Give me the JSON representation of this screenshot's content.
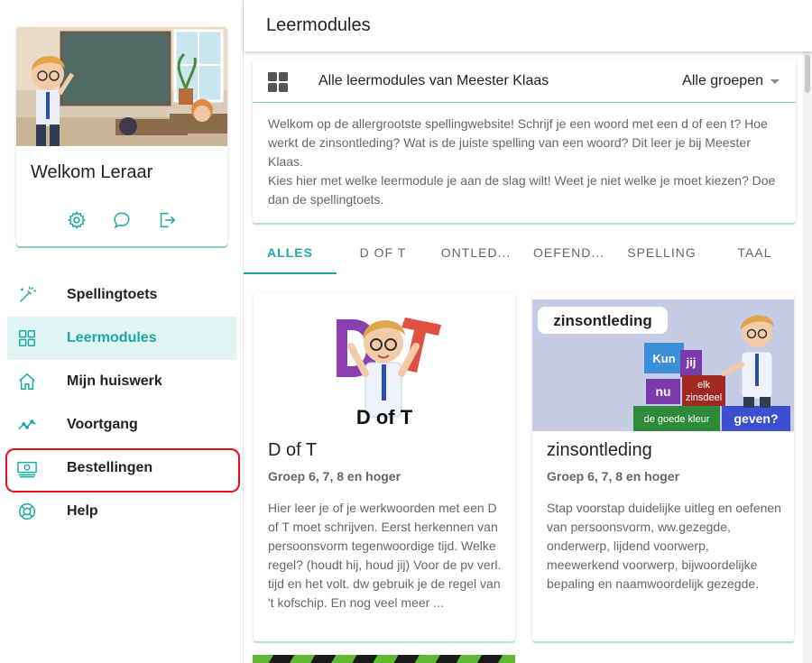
{
  "sidebar": {
    "welcome": "Welkom Leraar",
    "actions": [
      {
        "icon": "gear-icon"
      },
      {
        "icon": "chat-icon"
      },
      {
        "icon": "logout-icon"
      }
    ],
    "nav": [
      {
        "label": "Spellingtoets",
        "icon": "magic-wand-icon"
      },
      {
        "label": "Leermodules",
        "icon": "grid-icon",
        "active": true
      },
      {
        "label": "Mijn huiswerk",
        "icon": "home-icon"
      },
      {
        "label": "Voortgang",
        "icon": "trend-icon"
      },
      {
        "label": "Bestellingen",
        "icon": "money-icon"
      },
      {
        "label": "Help",
        "icon": "lifebuoy-icon"
      }
    ]
  },
  "header": {
    "title": "Leermodules"
  },
  "info": {
    "title": "Alle leermodules van Meester Klaas",
    "group_select": "Alle groepen",
    "body_line1": "Welkom op de allergrootste spellingwebsite! Schrijf je een woord met een d of een t? Hoe werkt de zinsontleding? Wat is de juiste spelling van een woord? Dit leer je bij Meester Klaas.",
    "body_line2": "Kies hier met welke leermodule je aan de slag wilt! Weet je niet welke je moet kiezen? Doe dan de spellingtoets."
  },
  "tabs": [
    "ALLES",
    "D OF T",
    "ONTLED...",
    "OEFEND...",
    "SPELLING",
    "TAAL"
  ],
  "cards": [
    {
      "title": "D of T",
      "subtitle": "Groep 6, 7, 8 en hoger",
      "image_text": "D of T",
      "description": "Hier leer je of je werkwoorden met een D of T moet schrijven. Eerst herkennen van persoonsvorm tegenwoordige tijd. Welke regel? (houdt hij, houd jij) Voor de pv verl. tijd en het volt. dw gebruik je de regel van 't kofschip. En nog veel meer ..."
    },
    {
      "title": "zinsontleding",
      "subtitle": "Groep 6, 7, 8 en hoger",
      "image_text": "zinsontleding",
      "image_blocks": [
        "Kun",
        "jij",
        "elk",
        "zinsdeel",
        "nu",
        "de goede kleur",
        "geven?"
      ],
      "description": "Stap voorstap duidelijke uitleg en oefenen van persoonsvorm, ww.gezegde, onderwerp, lijdend voorwerp, meewerkend voorwerp, bijwoordelijke bepaling en naamwoordelijk gezegde."
    }
  ],
  "colors": {
    "accent": "#1aa9a1",
    "active_bg": "#dff4f3",
    "highlight": "#e0121a"
  }
}
